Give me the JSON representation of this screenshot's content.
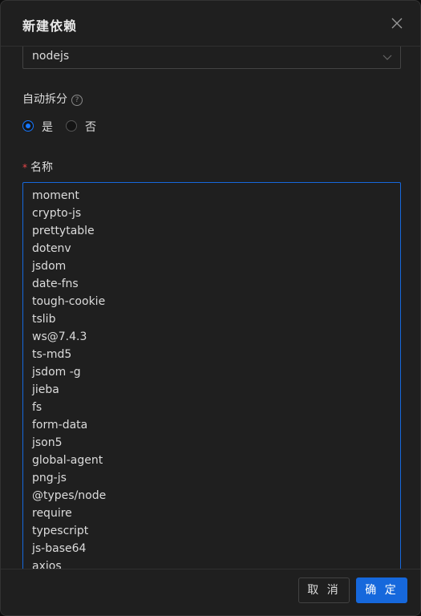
{
  "modal": {
    "title": "新建依赖"
  },
  "form": {
    "type_select": {
      "value": "nodejs"
    },
    "auto_split": {
      "label": "自动拆分",
      "help_symbol": "?",
      "options": [
        {
          "label": "是",
          "checked": true
        },
        {
          "label": "否",
          "checked": false
        }
      ]
    },
    "name": {
      "required_mark": "*",
      "label": "名称",
      "lines": [
        "moment",
        "crypto-js",
        "prettytable",
        "dotenv",
        "jsdom",
        "date-fns",
        "tough-cookie",
        "tslib",
        "ws@7.4.3",
        "ts-md5",
        "jsdom -g",
        "jieba",
        "fs",
        "form-data",
        "json5",
        "global-agent",
        "png-js",
        "@types/node",
        "require",
        "typescript",
        "js-base64",
        "axios"
      ]
    }
  },
  "footer": {
    "cancel_label": "取 消",
    "ok_label": "确 定"
  },
  "colors": {
    "accent": "#1668dc",
    "background": "#1f1f1f",
    "required": "#e84749"
  }
}
